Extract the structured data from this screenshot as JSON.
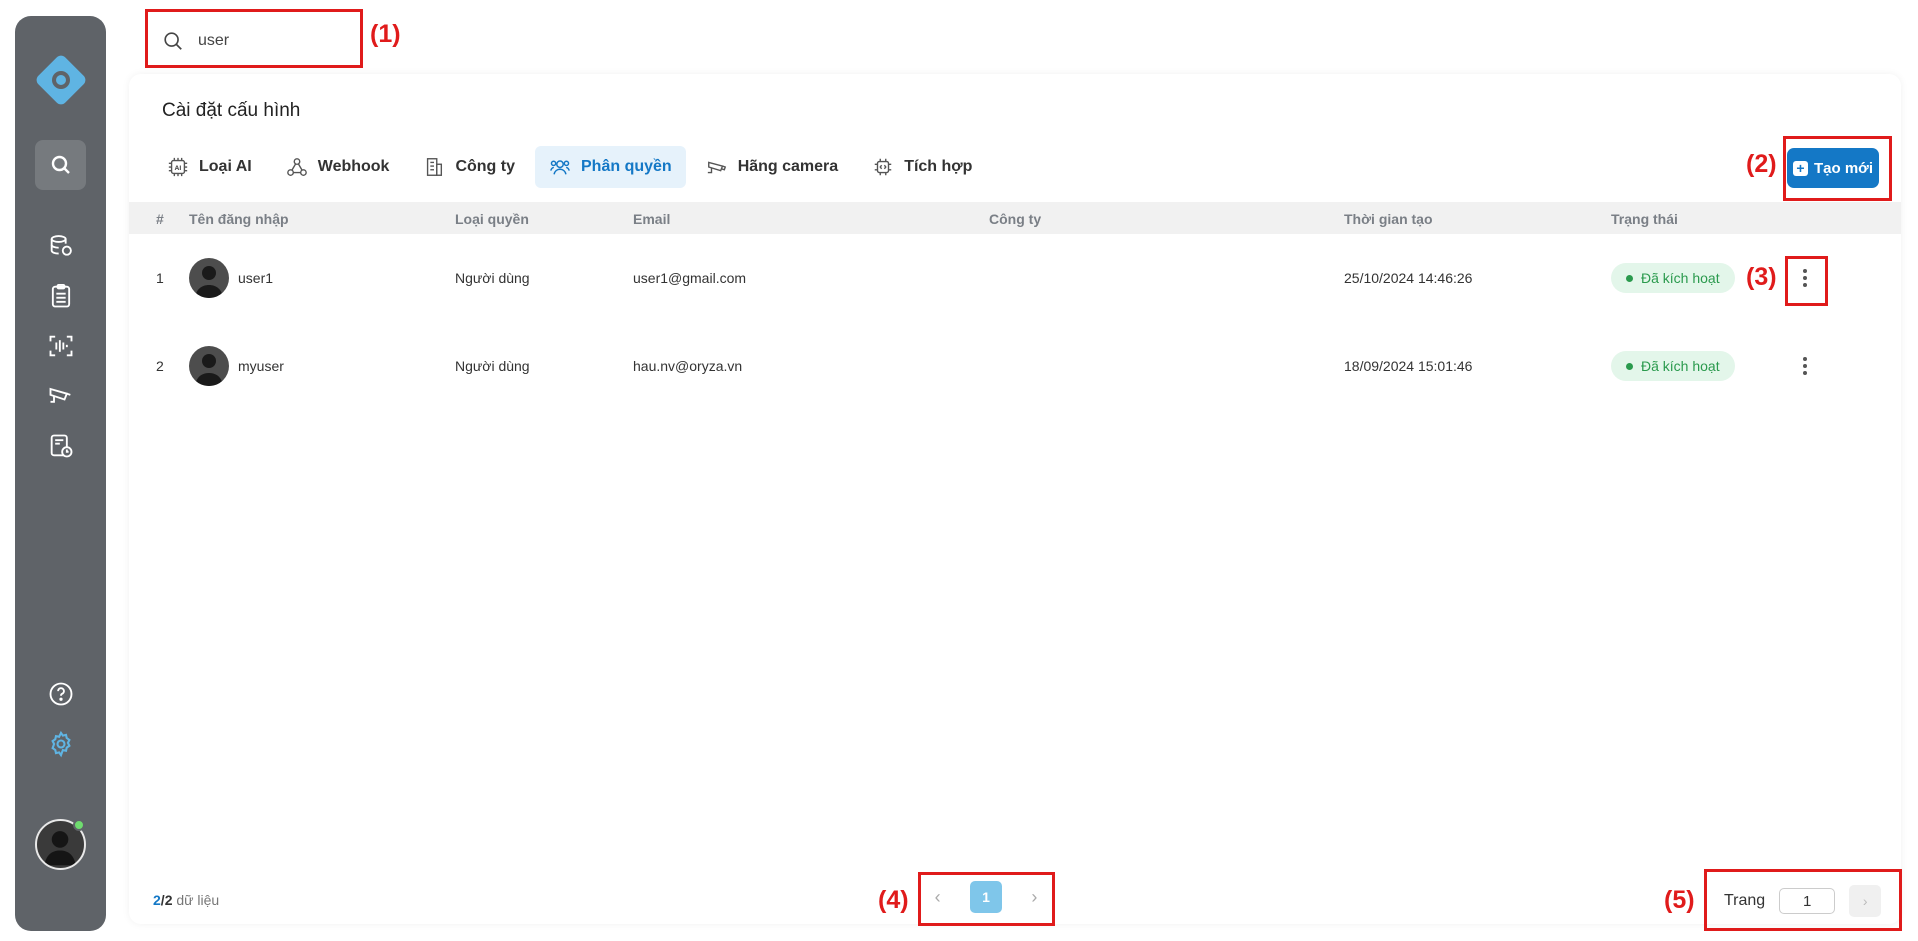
{
  "search": {
    "value": "user",
    "placeholder": ""
  },
  "card": {
    "title": "Cài đặt cấu hình",
    "tabs": [
      {
        "label": "Loại AI",
        "icon": "ai-chip-icon",
        "active": false
      },
      {
        "label": "Webhook",
        "icon": "webhook-icon",
        "active": false
      },
      {
        "label": "Công ty",
        "icon": "building-icon",
        "active": false
      },
      {
        "label": "Phân quyền",
        "icon": "users-permission-icon",
        "active": true
      },
      {
        "label": "Hãng camera",
        "icon": "camera-icon",
        "active": false
      },
      {
        "label": "Tích hợp",
        "icon": "integration-icon",
        "active": false
      }
    ],
    "create_label": "Tạo mới"
  },
  "table": {
    "headers": [
      "#",
      "Tên đăng nhập",
      "Loại quyền",
      "Email",
      "Công ty",
      "Thời gian tạo",
      "Trạng thái"
    ],
    "rows": [
      {
        "index": "1",
        "username": "user1",
        "role": "Người dùng",
        "email": "user1@gmail.com",
        "company": "",
        "created": "25/10/2024 14:46:26",
        "status": "Đã kích hoạt"
      },
      {
        "index": "2",
        "username": "myuser",
        "role": "Người dùng",
        "email": "hau.nv@oryza.vn",
        "company": "",
        "created": "18/09/2024 15:01:46",
        "status": "Đã kích hoạt"
      }
    ]
  },
  "footer": {
    "count_shown": "2",
    "count_sep": "/",
    "count_total": "2",
    "count_suffix": " dữ liệu",
    "prev": "‹",
    "page": "1",
    "next": "›",
    "goto_label": "Trang",
    "goto_value": "1"
  },
  "annotations": [
    "(1)",
    "(2)",
    "(3)",
    "(4)",
    "(5)"
  ],
  "colors": {
    "primary": "#1478c6",
    "sidebar": "#5f6368",
    "annotation": "#e01b1b",
    "active_badge": "#2a9a4d"
  }
}
